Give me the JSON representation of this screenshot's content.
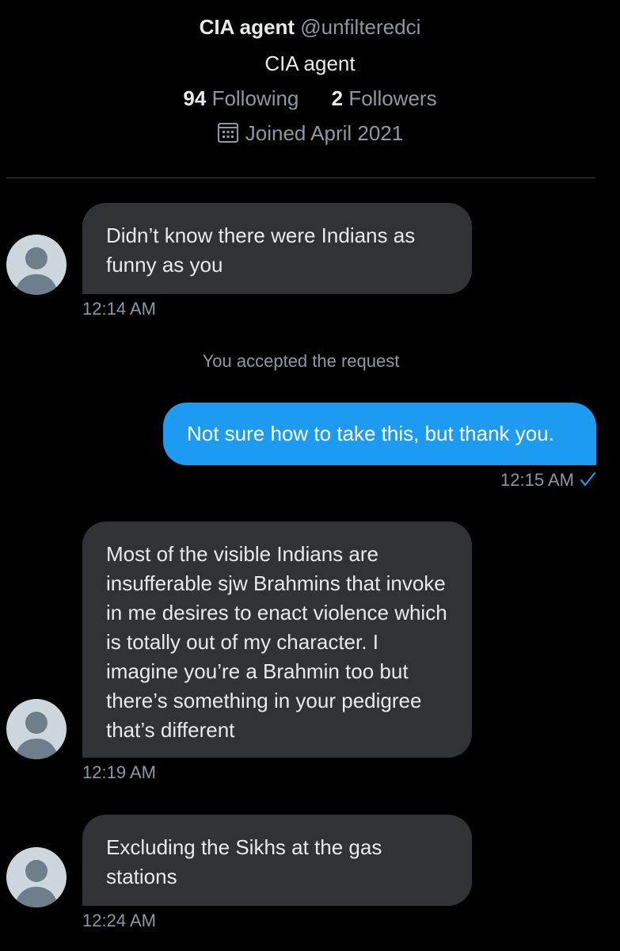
{
  "profile": {
    "name": "CIA agent",
    "handle": "@unfilteredci",
    "bio": "CIA agent",
    "following_count": "94",
    "following_label": "Following",
    "followers_count": "2",
    "followers_label": "Followers",
    "joined": "Joined April 2021"
  },
  "conversation": {
    "messages": [
      {
        "text": "Didn’t know there were Indians as funny as you",
        "time": "12:14 AM"
      },
      {
        "text": "Not sure how to take this, but thank you.",
        "time": "12:15 AM"
      },
      {
        "text": "Most of the visible Indians are insufferable sjw Brahmins that invoke in me desires to enact violence which is totally out of my character. I imagine you’re a Brahmin too but there’s something in your pedigree that’s different",
        "time": "12:19 AM"
      },
      {
        "text": "Excluding the Sikhs at the gas stations",
        "time": "12:24 AM"
      }
    ],
    "system_note": "You accepted the request"
  },
  "colors": {
    "background": "#000000",
    "incoming_bubble": "#2f3336",
    "outgoing_bubble": "#1d9bf0",
    "secondary_text": "#8b98a5",
    "avatar_bg": "#ccd6dd",
    "avatar_figure": "#6e7e8b"
  },
  "icons": {
    "joined": "calendar-icon",
    "read_receipt": "check-icon",
    "default_avatar": "person-silhouette-icon"
  }
}
